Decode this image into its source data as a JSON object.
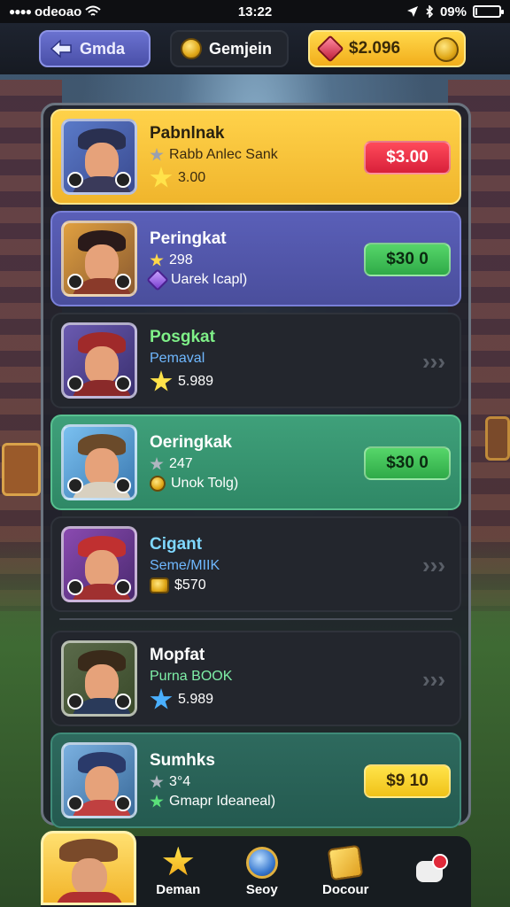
{
  "status": {
    "carrier": "odeoao",
    "time": "13:22",
    "battery": "09%",
    "battery_level": 0.09
  },
  "topbar": {
    "back_label": "Gmda",
    "mode_label": "Gemjein",
    "currency_amount": "$2.096"
  },
  "rows": [
    {
      "name": "Pabnlnak",
      "line1": "Rabb Anlec  Sank",
      "line2": "3.00",
      "price": "$3.00",
      "style": "yellow",
      "action": "red"
    },
    {
      "name": "Peringkat",
      "line1": "298",
      "line2": "Uarek Icapl)",
      "price": "$30 0",
      "style": "purple",
      "action": "green"
    },
    {
      "name": "Posgkat",
      "line1": "Pemaval",
      "line2": "5.989",
      "style": "dark",
      "action": "chevrons"
    },
    {
      "name": "Oeringkak",
      "line1": "247",
      "line2": "Unok Tolg)",
      "price": "$30 0",
      "style": "green",
      "action": "green"
    },
    {
      "name": "Cigant",
      "line1": "Seme/MIIK",
      "line2": "$570",
      "style": "dark",
      "action": "chevrons"
    },
    {
      "name": "Mopfat",
      "line1": "Purna BOOK",
      "line2": "5.989",
      "style": "dark",
      "action": "chevrons"
    },
    {
      "name": "Sumhks",
      "line1": "3°4",
      "line2": "Gmapr Ideaneal)",
      "price": "$9 10",
      "style": "teal",
      "action": "yellow"
    }
  ],
  "nav": {
    "items": [
      {
        "label": "Deman",
        "icon": "star-icon"
      },
      {
        "label": "Seoy",
        "icon": "orb-icon"
      },
      {
        "label": "Docour",
        "icon": "scroll-icon"
      },
      {
        "label": "",
        "icon": "chat-icon"
      }
    ]
  }
}
